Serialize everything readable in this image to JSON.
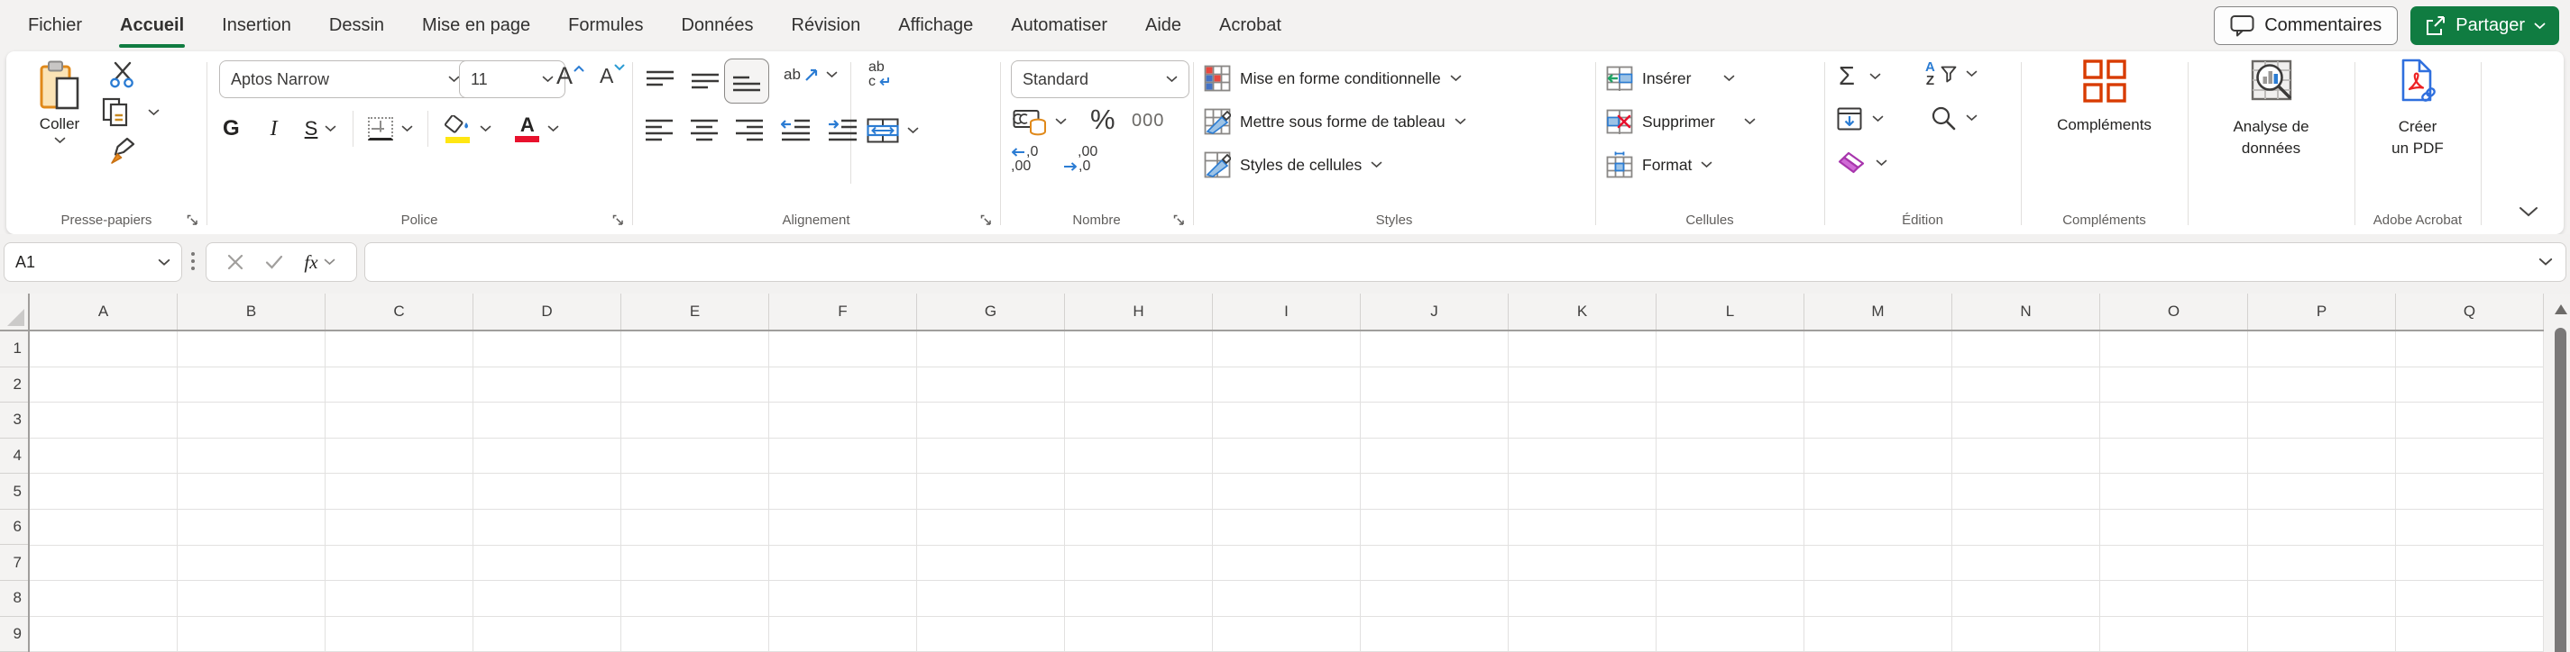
{
  "tab_bar": {
    "tabs": [
      {
        "label": "Fichier",
        "active": false
      },
      {
        "label": "Accueil",
        "active": true
      },
      {
        "label": "Insertion",
        "active": false
      },
      {
        "label": "Dessin",
        "active": false
      },
      {
        "label": "Mise en page",
        "active": false
      },
      {
        "label": "Formules",
        "active": false
      },
      {
        "label": "Données",
        "active": false
      },
      {
        "label": "Révision",
        "active": false
      },
      {
        "label": "Affichage",
        "active": false
      },
      {
        "label": "Automatiser",
        "active": false
      },
      {
        "label": "Aide",
        "active": false
      },
      {
        "label": "Acrobat",
        "active": false
      }
    ],
    "comments_label": "Commentaires",
    "share_label": "Partager"
  },
  "ribbon": {
    "clipboard": {
      "label": "Presse-papiers",
      "paste": "Coller"
    },
    "font": {
      "label": "Police",
      "name": "Aptos Narrow",
      "size": "11",
      "bold": "G",
      "italic": "I",
      "underline": "S"
    },
    "alignment": {
      "label": "Alignement",
      "orientation_text": "ab",
      "wrap_top": "ab",
      "wrap_bottom": "c"
    },
    "number": {
      "label": "Nombre",
      "format": "Standard",
      "percent": "%",
      "thousands": "000",
      "dec_inc_top": ",0",
      "dec_inc_bottom": ",00",
      "dec_dec_top": ",00",
      "dec_dec_bottom": ",0"
    },
    "styles": {
      "label": "Styles",
      "conditional_formatting": "Mise en forme conditionnelle",
      "format_as_table": "Mettre sous forme de tableau",
      "cell_styles": "Styles de cellules"
    },
    "cells": {
      "label": "Cellules",
      "insert": "Insérer",
      "delete": "Supprimer",
      "format": "Format"
    },
    "editing": {
      "label": "Édition",
      "autosum": "Σ",
      "sort_a": "A",
      "sort_z": "Z"
    },
    "addins": {
      "label": "Compléments",
      "button": "Compléments"
    },
    "analysis": {
      "button_line1": "Analyse de",
      "button_line2": "données"
    },
    "acrobat": {
      "label": "Adobe Acrobat",
      "button_line1": "Créer",
      "button_line2": "un PDF"
    }
  },
  "formula_bar": {
    "name_box": "A1",
    "fx_label": "fx",
    "formula_value": ""
  },
  "grid": {
    "columns": [
      "A",
      "B",
      "C",
      "D",
      "E",
      "F",
      "G",
      "H",
      "I",
      "J",
      "K",
      "L",
      "M",
      "N",
      "O",
      "P",
      "Q"
    ],
    "rows": [
      "1",
      "2",
      "3",
      "4",
      "5",
      "6",
      "7",
      "8",
      "9"
    ]
  },
  "colors": {
    "excel_green": "#107C41",
    "accent_blue": "#2B7CD3",
    "accent_orange": "#D83B01",
    "accent_red": "#E8112D",
    "fill_yellow": "#FFE612",
    "eraser_magenta": "#A836AD"
  }
}
